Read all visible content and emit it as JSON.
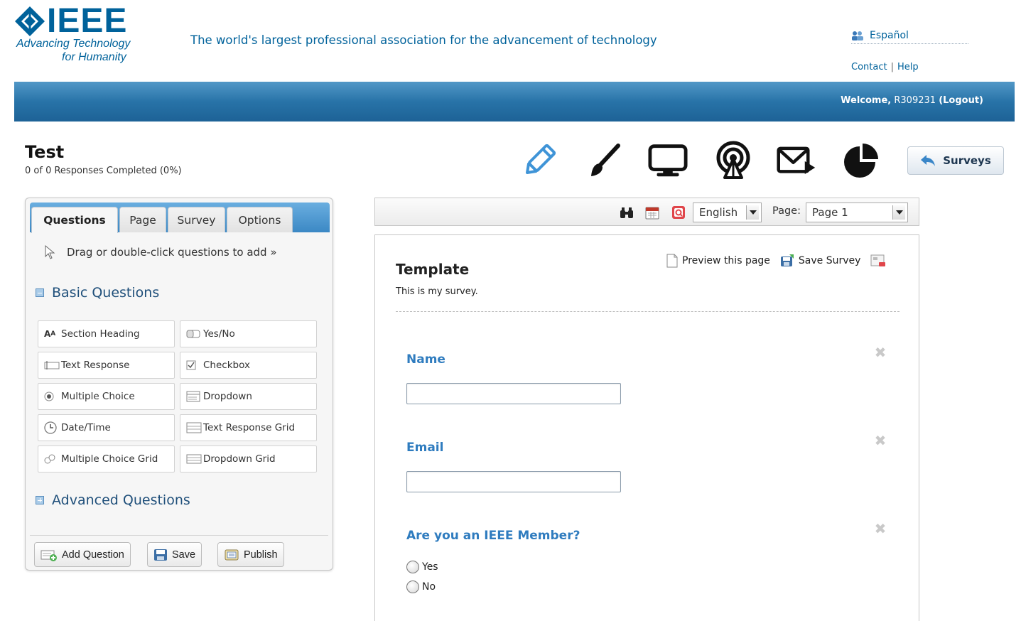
{
  "header": {
    "logo_text": "IEEE",
    "logo_sub1": "Advancing Technology",
    "logo_sub2": "for Humanity",
    "tagline": "The world's largest professional association for the advancement of technology",
    "language_link": "Español",
    "contact_link": "Contact",
    "link_sep": "|",
    "help_link": "Help",
    "welcome_label": "Welcome,",
    "username": "R309231",
    "logout": "(Logout)"
  },
  "survey": {
    "title": "Test",
    "status": "0 of 0 Responses Completed (0%)"
  },
  "toolbar_icons": [
    "pencil-icon",
    "brush-icon",
    "monitor-icon",
    "broadcast-icon",
    "mail-icon",
    "pie-chart-icon"
  ],
  "surveys_button": "Surveys",
  "left_panel": {
    "tabs": [
      "Questions",
      "Page",
      "Survey",
      "Options"
    ],
    "active_tab": "Questions",
    "drag_hint": "Drag or double-click questions to add »",
    "basic_heading": "Basic Questions",
    "basic_questions": [
      "Section Heading",
      "Yes/No",
      "Text Response",
      "Checkbox",
      "Multiple Choice",
      "Dropdown",
      "Date/Time",
      "Text Response Grid",
      "Multiple Choice Grid",
      "Dropdown Grid"
    ],
    "advanced_heading": "Advanced Questions",
    "actions": {
      "add": "Add Question",
      "save": "Save",
      "publish": "Publish"
    }
  },
  "right_toolbar": {
    "language": "English",
    "page_label": "Page:",
    "page_value": "Page 1"
  },
  "canvas": {
    "title": "Template",
    "description": "This is my survey.",
    "preview": "Preview this page",
    "save_survey": "Save Survey",
    "questions": [
      {
        "label": "Name",
        "type": "text"
      },
      {
        "label": "Email",
        "type": "text"
      },
      {
        "label": "Are you an IEEE Member?",
        "type": "radio",
        "options": [
          "Yes",
          "No"
        ]
      }
    ]
  },
  "colors": {
    "brand_blue": "#00629b",
    "bar_blue": "#2873a8",
    "question_blue": "#2f7cbf"
  }
}
